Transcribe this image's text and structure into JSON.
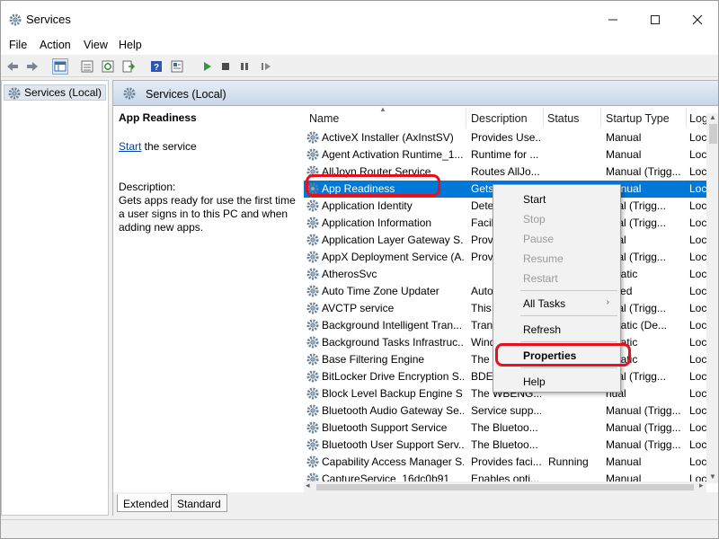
{
  "window": {
    "title": "Services",
    "app_icon": "gear-icon"
  },
  "menu": [
    "File",
    "Action",
    "View",
    "Help"
  ],
  "tree": {
    "root_label": "Services (Local)"
  },
  "main": {
    "header_title": "Services (Local)",
    "detail": {
      "service_name": "App Readiness",
      "start_link": "Start",
      "start_suffix": " the service",
      "description_label": "Description:",
      "description_text": "Gets apps ready for use the first time a user signs in to this PC and when adding new apps."
    },
    "columns": {
      "name": "Name",
      "description": "Description",
      "status": "Status",
      "startup_type": "Startup Type",
      "log_on_as": "Log"
    },
    "rows": [
      {
        "name": "ActiveX Installer (AxInstSV)",
        "description": "Provides Use...",
        "status": "",
        "startup": "Manual",
        "log": "Loc"
      },
      {
        "name": "Agent Activation Runtime_1...",
        "description": "Runtime for ...",
        "status": "",
        "startup": "Manual",
        "log": "Loc"
      },
      {
        "name": "AllJoyn Router Service",
        "description": "Routes AllJo...",
        "status": "",
        "startup": "Manual (Trigg...",
        "log": "Loc"
      },
      {
        "name": "App Readiness",
        "description": "Gets",
        "status": "",
        "startup": "Manual",
        "log": "Loc",
        "selected": true
      },
      {
        "name": "Application Identity",
        "description": "Dete",
        "status": "",
        "startup": "nual (Trigg...",
        "log": "Loc"
      },
      {
        "name": "Application Information",
        "description": "Facili",
        "status": "",
        "startup": "nual (Trigg...",
        "log": "Loc"
      },
      {
        "name": "Application Layer Gateway S...",
        "description": "Provi",
        "status": "",
        "startup": "nual",
        "log": "Loc"
      },
      {
        "name": "AppX Deployment Service (A...",
        "description": "Provi",
        "status": "",
        "startup": "nual (Trigg...",
        "log": "Loc"
      },
      {
        "name": "AtherosSvc",
        "description": "",
        "status": "",
        "startup": "omatic",
        "log": "Loc"
      },
      {
        "name": "Auto Time Zone Updater",
        "description": "Auto",
        "status": "",
        "startup": "abled",
        "log": "Loc"
      },
      {
        "name": "AVCTP service",
        "description": "This",
        "status": "",
        "startup": "nual (Trigg...",
        "log": "Loc"
      },
      {
        "name": "Background Intelligent Tran...",
        "description": "Trans",
        "status": "",
        "startup": "omatic (De...",
        "log": "Loc"
      },
      {
        "name": "Background Tasks Infrastruc...",
        "description": "Wind",
        "status": "",
        "startup": "omatic",
        "log": "Loc"
      },
      {
        "name": "Base Filtering Engine",
        "description": "The B",
        "status": "",
        "startup": "omatic",
        "log": "Loc"
      },
      {
        "name": "BitLocker Drive Encryption S...",
        "description": "BDES",
        "status": "",
        "startup": "nual (Trigg...",
        "log": "Loc"
      },
      {
        "name": "Block Level Backup Engine S...",
        "description": "The WBENG...",
        "status": "",
        "startup": "nual",
        "log": "Loc"
      },
      {
        "name": "Bluetooth Audio Gateway Se...",
        "description": "Service supp...",
        "status": "",
        "startup": "Manual (Trigg...",
        "log": "Loc"
      },
      {
        "name": "Bluetooth Support Service",
        "description": "The Bluetoo...",
        "status": "",
        "startup": "Manual (Trigg...",
        "log": "Loc"
      },
      {
        "name": "Bluetooth User Support Serv...",
        "description": "The Bluetoo...",
        "status": "",
        "startup": "Manual (Trigg...",
        "log": "Loc"
      },
      {
        "name": "Capability Access Manager S...",
        "description": "Provides faci...",
        "status": "Running",
        "startup": "Manual",
        "log": "Loc"
      },
      {
        "name": "CaptureService_16dc0b91",
        "description": "Enables opti...",
        "status": "",
        "startup": "Manual",
        "log": "Loc"
      }
    ]
  },
  "tabs": [
    "Extended",
    "Standard"
  ],
  "context_menu": {
    "items": [
      {
        "label": "Start",
        "enabled": true
      },
      {
        "label": "Stop",
        "enabled": false
      },
      {
        "label": "Pause",
        "enabled": false
      },
      {
        "label": "Resume",
        "enabled": false
      },
      {
        "label": "Restart",
        "enabled": false
      },
      {
        "label": "All Tasks",
        "enabled": true,
        "submenu": true
      },
      {
        "label": "Refresh",
        "enabled": true
      },
      {
        "label": "Properties",
        "enabled": true,
        "bold": true
      },
      {
        "label": "Help",
        "enabled": true
      }
    ]
  },
  "colors": {
    "selection": "#0078d7",
    "highlight_annotation": "#e8101c",
    "link": "#0645ad"
  }
}
